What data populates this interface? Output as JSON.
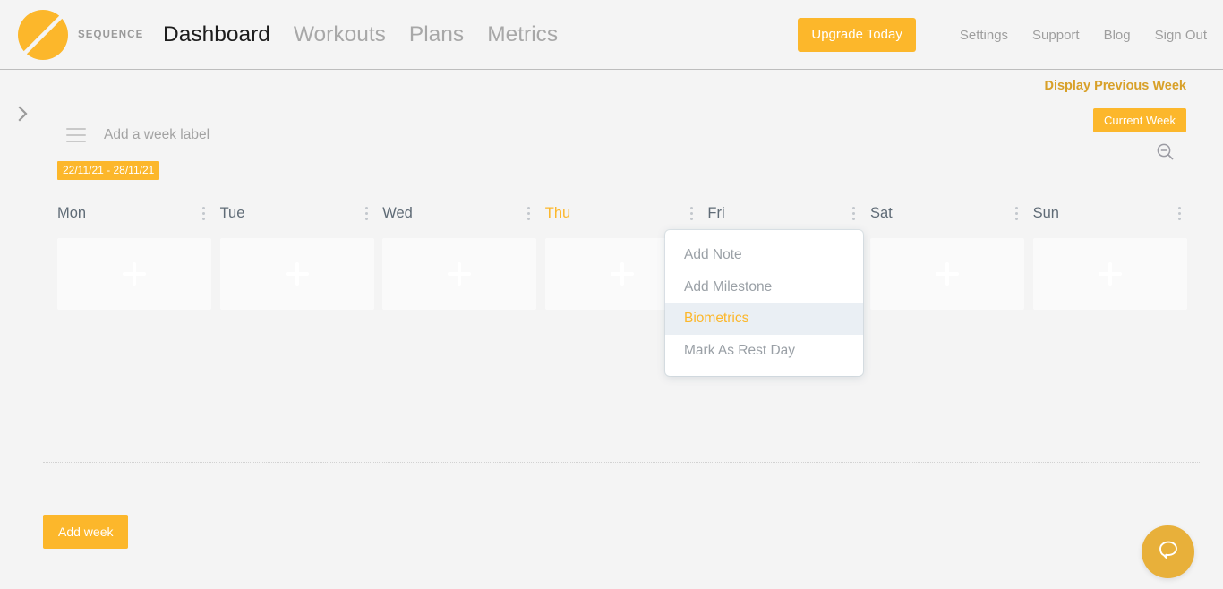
{
  "brand": {
    "logo_icon": "sequence-circle-slash-logo",
    "name": "SEQUENCE"
  },
  "nav": {
    "primary": [
      {
        "label": "Dashboard",
        "active": true
      },
      {
        "label": "Workouts",
        "active": false
      },
      {
        "label": "Plans",
        "active": false
      },
      {
        "label": "Metrics",
        "active": false
      }
    ],
    "upgrade_label": "Upgrade Today",
    "secondary": [
      {
        "label": "Settings"
      },
      {
        "label": "Support"
      },
      {
        "label": "Blog"
      },
      {
        "label": "Sign Out"
      }
    ]
  },
  "week_controls": {
    "previous_week_label": "Display Previous Week",
    "current_week_label": "Current Week",
    "zoom_out_icon": "zoom-out-icon",
    "sidebar_toggle_icon": "chevron-right-icon"
  },
  "week": {
    "menu_icon": "hamburger-icon",
    "label_value": "",
    "label_placeholder": "Add a week label",
    "date_range": "22/11/21 - 28/11/21",
    "days": [
      {
        "name": "Mon",
        "today": false,
        "add_icon": "plus-icon"
      },
      {
        "name": "Tue",
        "today": false,
        "add_icon": "plus-icon"
      },
      {
        "name": "Wed",
        "today": false,
        "add_icon": "plus-icon"
      },
      {
        "name": "Thu",
        "today": true,
        "add_icon": "plus-icon"
      },
      {
        "name": "Fri",
        "today": false,
        "add_icon": "plus-icon"
      },
      {
        "name": "Sat",
        "today": false,
        "add_icon": "plus-icon"
      },
      {
        "name": "Sun",
        "today": false,
        "add_icon": "plus-icon"
      }
    ]
  },
  "context_menu": {
    "open_for_day": "Thu",
    "items": [
      {
        "label": "Add Note",
        "highlighted": false
      },
      {
        "label": "Add Milestone",
        "highlighted": false
      },
      {
        "label": "Biometrics",
        "highlighted": true
      },
      {
        "label": "Mark As Rest Day",
        "highlighted": false
      }
    ]
  },
  "footer": {
    "add_week_label": "Add week"
  },
  "help": {
    "icon": "chat-bubble-icon"
  },
  "colors": {
    "accent": "#fcb72b",
    "accent_dark": "#d8a028",
    "page_bg": "#f4f4f4",
    "menu_highlight_bg": "#eaeff4",
    "day_label": "#5f6b76"
  }
}
